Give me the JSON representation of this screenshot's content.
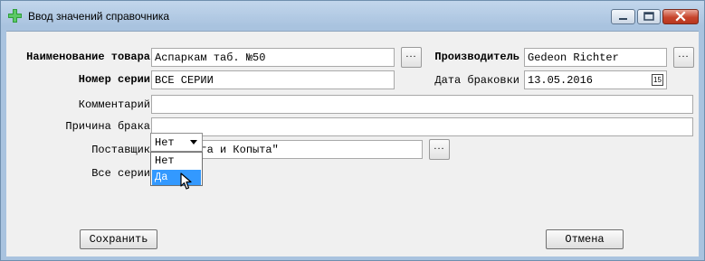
{
  "window": {
    "title": "Ввод значений справочника"
  },
  "form": {
    "product": {
      "label": "Наименование товара",
      "value": "Аспаркам таб. №50"
    },
    "manufacturer": {
      "label": "Производитель",
      "value": "Gedeon Richter"
    },
    "series_number": {
      "label": "Номер серии",
      "value": "ВСЕ СЕРИИ"
    },
    "reject_date": {
      "label": "Дата браковки",
      "value": "13.05.2016",
      "calendar_day": "15"
    },
    "comment": {
      "label": "Комментарий",
      "value": ""
    },
    "reject_reason": {
      "label": "Причина брака",
      "value": ""
    },
    "supplier": {
      "label": "Поставщик",
      "value": "ООО \"Рога и Копыта\""
    },
    "all_series": {
      "label": "Все серии",
      "value": "Нет",
      "options": [
        "Нет",
        "Да"
      ],
      "highlighted_option": "Да"
    },
    "browse_label": "..."
  },
  "buttons": {
    "save": "Сохранить",
    "cancel": "Отмена"
  },
  "colors": {
    "title_gradient": "#c2d6ec",
    "dialog_bg": "#f0f0f0",
    "selection": "#3399ff",
    "close_button": "#c7442c"
  },
  "icons": {
    "app": "green-cross-icon",
    "minimize": "minimize-icon",
    "maximize": "maximize-icon",
    "close": "close-icon",
    "calendar": "calendar-icon",
    "dropdown": "chevron-down-icon",
    "cursor": "mouse-pointer-icon"
  }
}
